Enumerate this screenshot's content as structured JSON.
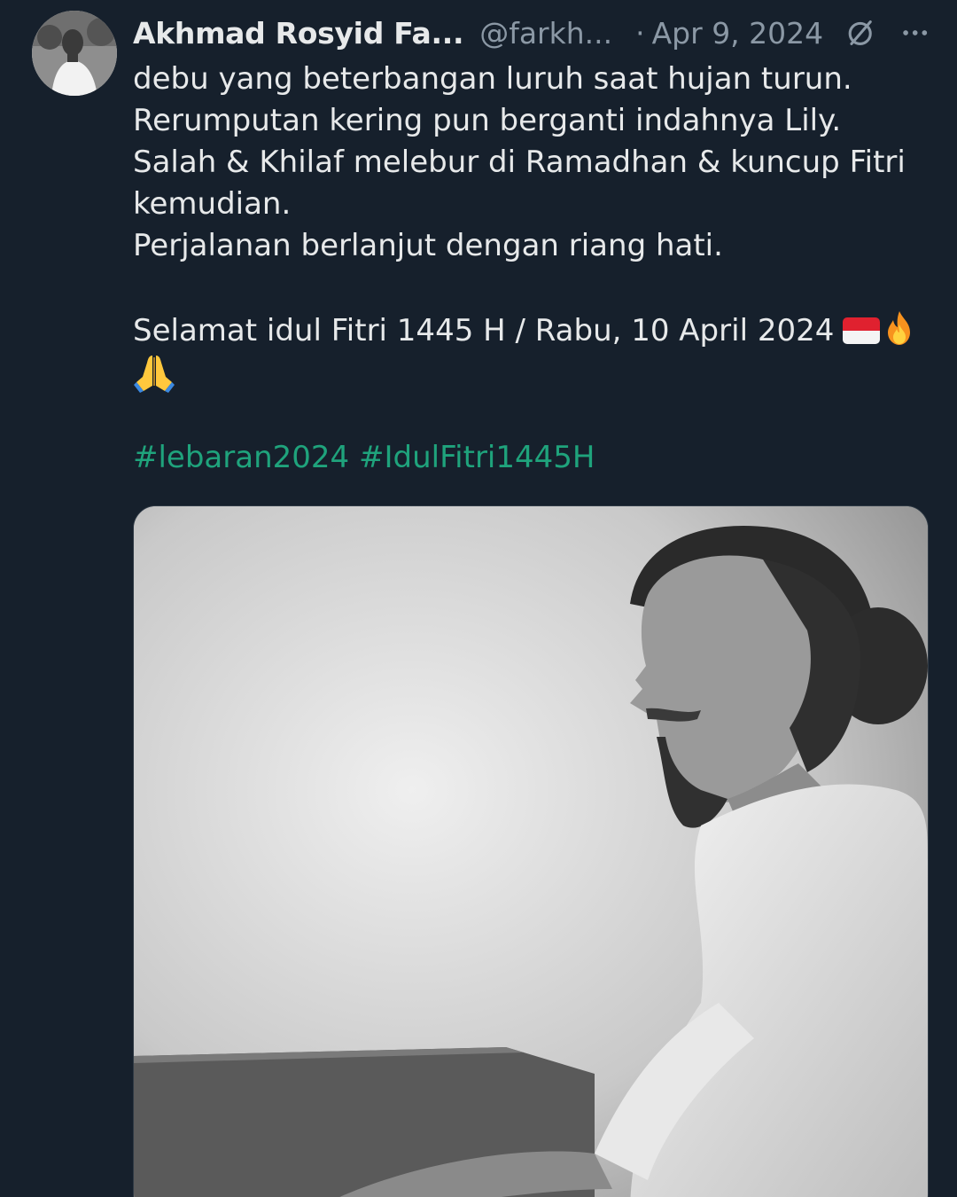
{
  "post": {
    "author_name": "Akhmad Rosyid Fa...",
    "author_handle": "@farkh...",
    "separator": "·",
    "date": "Apr 9, 2024",
    "grok_icon": "grok-icon",
    "more_icon": "more-icon",
    "text_lines": [
      "debu yang beterbangan luruh saat hujan turun.",
      "Rerumputan kering pun berganti indahnya Lily.",
      "Salah & Khilaf melebur di Ramadhan & kuncup Fitri",
      "kemudian.",
      "Perjalanan berlanjut dengan riang hati."
    ],
    "greeting": "Selamat idul Fitri 1445 H / Rabu, 10 April 2024",
    "emojis": [
      "indonesia-flag",
      "fire",
      "folded-hands"
    ],
    "hashtags": [
      "#lebaran2024",
      "#IdulFitri1445H"
    ],
    "colors": {
      "background": "#16202c",
      "text": "#e7e9ea",
      "secondary": "#8b98a5",
      "hashtag": "#1fa37c"
    }
  }
}
